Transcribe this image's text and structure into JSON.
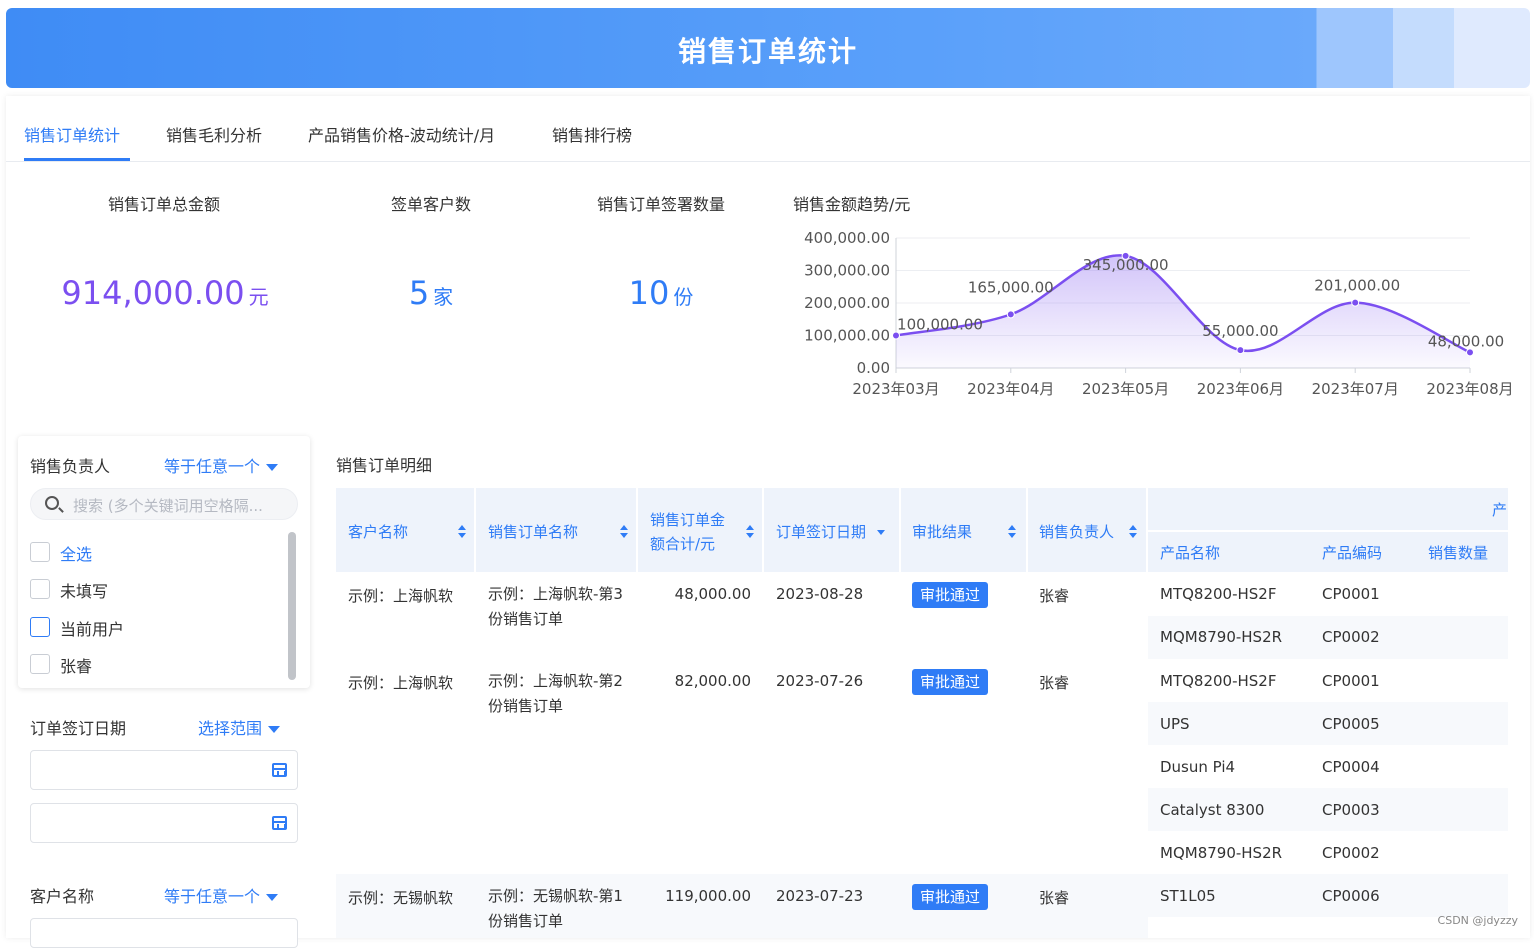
{
  "header": {
    "title": "销售订单统计"
  },
  "tabs": [
    {
      "label": "销售订单统计",
      "active": true
    },
    {
      "label": "销售毛利分析",
      "active": false
    },
    {
      "label": "产品销售价格-波动统计/月",
      "active": false
    },
    {
      "label": "销售排行榜",
      "active": false
    }
  ],
  "kpis": [
    {
      "label": "销售订单总金额",
      "value": "914,000.00",
      "unit": "元",
      "color": "#7b4ff0"
    },
    {
      "label": "签单客户数",
      "value": "5",
      "unit": "家",
      "color": "#2f7cf6"
    },
    {
      "label": "销售订单签署数量",
      "value": "10",
      "unit": "份",
      "color": "#2f7cf6"
    }
  ],
  "chart_data": {
    "type": "area",
    "title": "销售金额趋势/元",
    "categories": [
      "2023年03月",
      "2023年04月",
      "2023年05月",
      "2023年06月",
      "2023年07月",
      "2023年08月"
    ],
    "values": [
      100000,
      165000,
      345000,
      55000,
      201000,
      48000
    ],
    "data_labels": [
      "100,000.00",
      "165,000.00",
      "345,000.00",
      "55,000.00",
      "201,000.00",
      "48,000.00"
    ],
    "y_ticks": [
      "400,000.00",
      "300,000.00",
      "200,000.00",
      "100,000.00",
      "0.00"
    ],
    "ylim": [
      0,
      400000
    ],
    "grid": true,
    "line_color": "#7b4ff0"
  },
  "filters": {
    "owner": {
      "label": "销售负责人",
      "mode": "等于任意一个",
      "search_placeholder": "搜索 (多个关键词用空格隔...",
      "options": [
        {
          "label": "全选",
          "highlight": true
        },
        {
          "label": "未填写",
          "highlight": false
        },
        {
          "label": "当前用户",
          "highlight": false
        },
        {
          "label": "张睿",
          "highlight": false
        }
      ]
    },
    "date": {
      "label": "订单签订日期",
      "mode": "选择范围"
    },
    "customer": {
      "label": "客户名称",
      "mode": "等于任意一个"
    }
  },
  "table": {
    "title": "销售订单明细",
    "group_header": "产",
    "headers": {
      "customer": "客户名称",
      "order_name": "销售订单名称",
      "amount_l1": "销售订单金",
      "amount_l2": "额合计/元",
      "date": "订单签订日期",
      "approval": "审批结果",
      "owner": "销售负责人",
      "product_name": "产品名称",
      "product_code": "产品编码",
      "qty": "销售数量"
    },
    "orders": [
      {
        "customer": "示例：上海帆软",
        "order_name": "示例：上海帆软-第3份销售订单",
        "amount": "48,000.00",
        "date": "2023-08-28",
        "approval": "审批通过",
        "owner": "张睿"
      },
      {
        "customer": "示例：上海帆软",
        "order_name": "示例：上海帆软-第2份销售订单",
        "amount": "82,000.00",
        "date": "2023-07-26",
        "approval": "审批通过",
        "owner": "张睿"
      },
      {
        "customer": "示例：无锡帆软",
        "order_name": "示例：无锡帆软-第1份销售订单",
        "amount": "119,000.00",
        "date": "2023-07-23",
        "approval": "审批通过",
        "owner": "张睿"
      }
    ],
    "products": [
      {
        "name": "MTQ8200-HS2F",
        "code": "CP0001"
      },
      {
        "name": "MQM8790-HS2R",
        "code": "CP0002"
      },
      {
        "name": "MTQ8200-HS2F",
        "code": "CP0001"
      },
      {
        "name": "UPS",
        "code": "CP0005"
      },
      {
        "name": "Dusun Pi4",
        "code": "CP0004"
      },
      {
        "name": "Catalyst 8300",
        "code": "CP0003"
      },
      {
        "name": "MQM8790-HS2R",
        "code": "CP0002"
      },
      {
        "name": "ST1L05",
        "code": "CP0006"
      }
    ]
  },
  "watermark": "CSDN @jdyzzy"
}
